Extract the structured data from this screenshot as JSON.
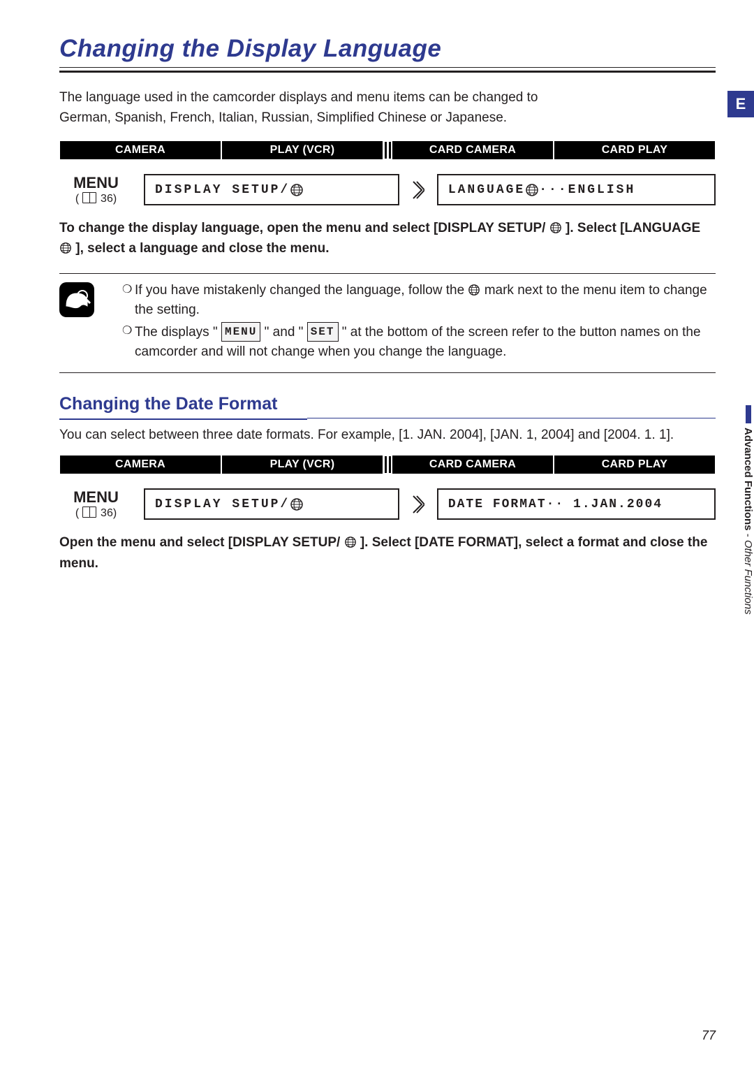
{
  "title": "Changing the Display Language",
  "e_box": "E",
  "intro": "The language used in the camcorder displays and menu items can be changed to German, Spanish, French, Italian, Russian, Simplified Chinese or Japanese.",
  "modes1": {
    "m1": "CAMERA",
    "m2": "PLAY (VCR)",
    "m3": "CARD CAMERA",
    "m4": "CARD PLAY"
  },
  "menu_label": "MENU",
  "menu_page": "36",
  "menu1_left": "DISPLAY SETUP/",
  "menu1_right": "LANGUAGE",
  "menu1_right_val": "···ENGLISH",
  "instruct1_a": "To change the display language, open the menu and select [DISPLAY SETUP/",
  "instruct1_b": "]. Select [LANGUAGE",
  "instruct1_c": "], select a language and close the menu.",
  "note1_a": "If you have mistakenly changed the language, follow the ",
  "note1_b": " mark next to the menu item to change the setting.",
  "note2_a": "The displays \" ",
  "note2_menu": "MENU",
  "note2_b": " \" and \" ",
  "note2_set": "SET",
  "note2_c": " \" at the bottom of the screen refer to the button names on the camcorder and will not change when you change the language.",
  "h2": "Changing the Date Format",
  "body2": "You can select between three date formats. For example, [1. JAN. 2004], [JAN. 1, 2004] and [2004. 1. 1].",
  "modes2": {
    "m1": "CAMERA",
    "m2": "PLAY (VCR)",
    "m3": "CARD CAMERA",
    "m4": "CARD PLAY"
  },
  "menu2_left": "DISPLAY SETUP/",
  "menu2_right": "DATE FORMAT·· 1.JAN.2004",
  "instruct2_a": "Open the menu and select [DISPLAY SETUP/",
  "instruct2_b": "]. Select [DATE FORMAT], select a format and close the menu.",
  "side_bold": "Advanced Functions",
  "side_sep": " - ",
  "side_ital": "Other Functions",
  "page_num": "77"
}
